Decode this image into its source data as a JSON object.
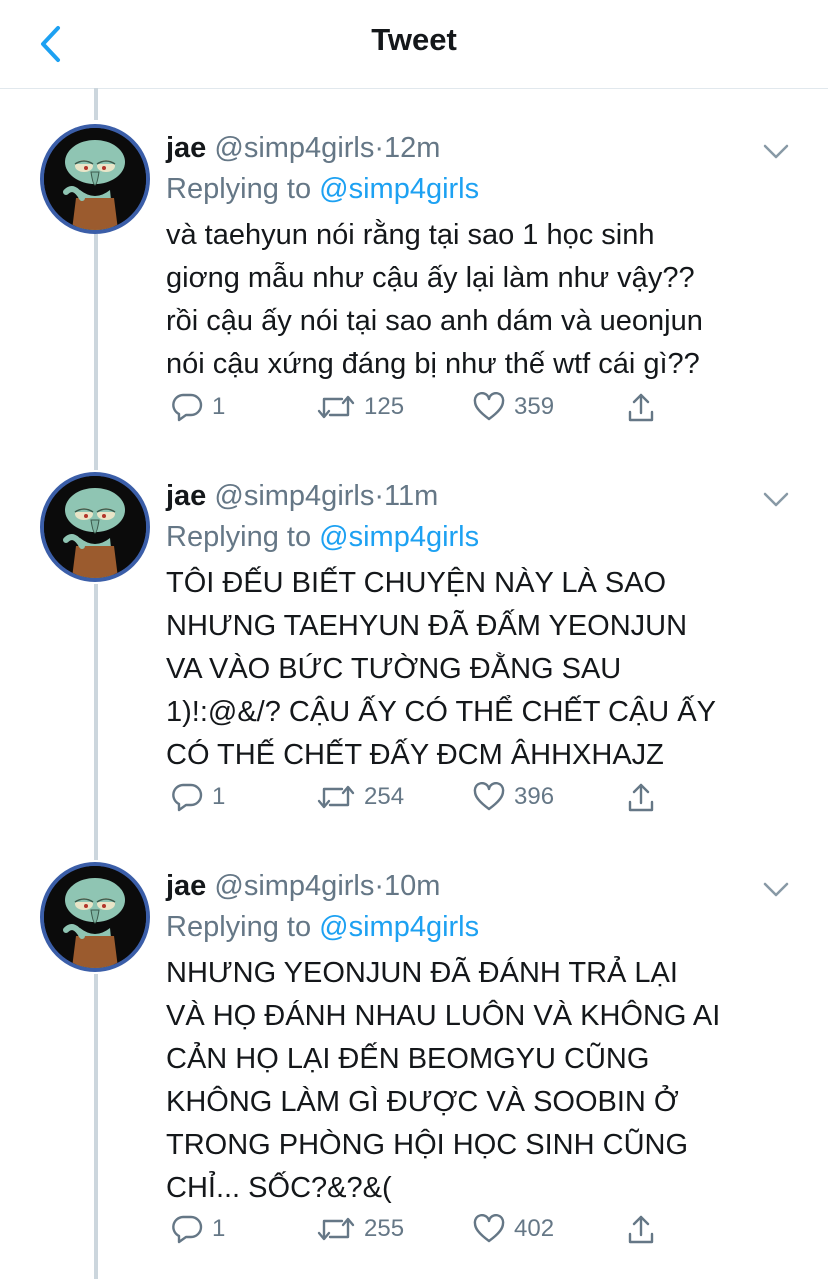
{
  "header": {
    "title": "Tweet"
  },
  "tweets": [
    {
      "name": "jae",
      "handle": "@simp4girls",
      "dot": "·",
      "time": "12m",
      "replying_prefix": "Replying to ",
      "replying_to": "@simp4girls",
      "lines": [
        "và taehyun nói rằng tại sao 1 học sinh",
        "giơng mẫu như cậu ấy lại làm như vậy??",
        "rồi cậu ấy nói tại sao anh dám và ueonjun",
        "nói cậu xứng đáng bị như thế wtf cái gì??"
      ],
      "replies": "1",
      "retweets": "125",
      "likes": "359"
    },
    {
      "name": "jae",
      "handle": "@simp4girls",
      "dot": "·",
      "time": "11m",
      "replying_prefix": "Replying to ",
      "replying_to": "@simp4girls",
      "lines": [
        "TÔI ĐẾU BIẾT CHUYỆN NÀY LÀ SAO",
        "NHƯNG TAEHYUN ĐÃ ĐẤM YEONJUN",
        "VA VÀO BỨC TƯỜNG ĐẰNG SAU",
        "1)!:@&/? CẬU ẤY CÓ THỂ CHẾT CẬU ẤY",
        "CÓ THẾ CHẾT ĐẤY ĐCM ÂHHXHAJZ"
      ],
      "replies": "1",
      "retweets": "254",
      "likes": "396"
    },
    {
      "name": "jae",
      "handle": "@simp4girls",
      "dot": "·",
      "time": "10m",
      "replying_prefix": "Replying to ",
      "replying_to": "@simp4girls",
      "lines": [
        "NHƯNG YEONJUN ĐÃ ĐÁNH TRẢ LẠI",
        "VÀ HỌ ĐÁNH NHAU LUÔN VÀ KHÔNG AI",
        "CẢN HỌ LẠI ĐẾN BEOMGYU CŨNG",
        "KHÔNG LÀM GÌ ĐƯỢC VÀ SOOBIN Ở",
        "TRONG PHÒNG HỘI HỌC SINH CŨNG",
        "CHỈ... SỐC?&?&("
      ],
      "replies": "1",
      "retweets": "255",
      "likes": "402"
    }
  ],
  "colors": {
    "accent": "#1da1f2",
    "secondary_text": "#657786",
    "thread_line": "#ccd6dd"
  }
}
